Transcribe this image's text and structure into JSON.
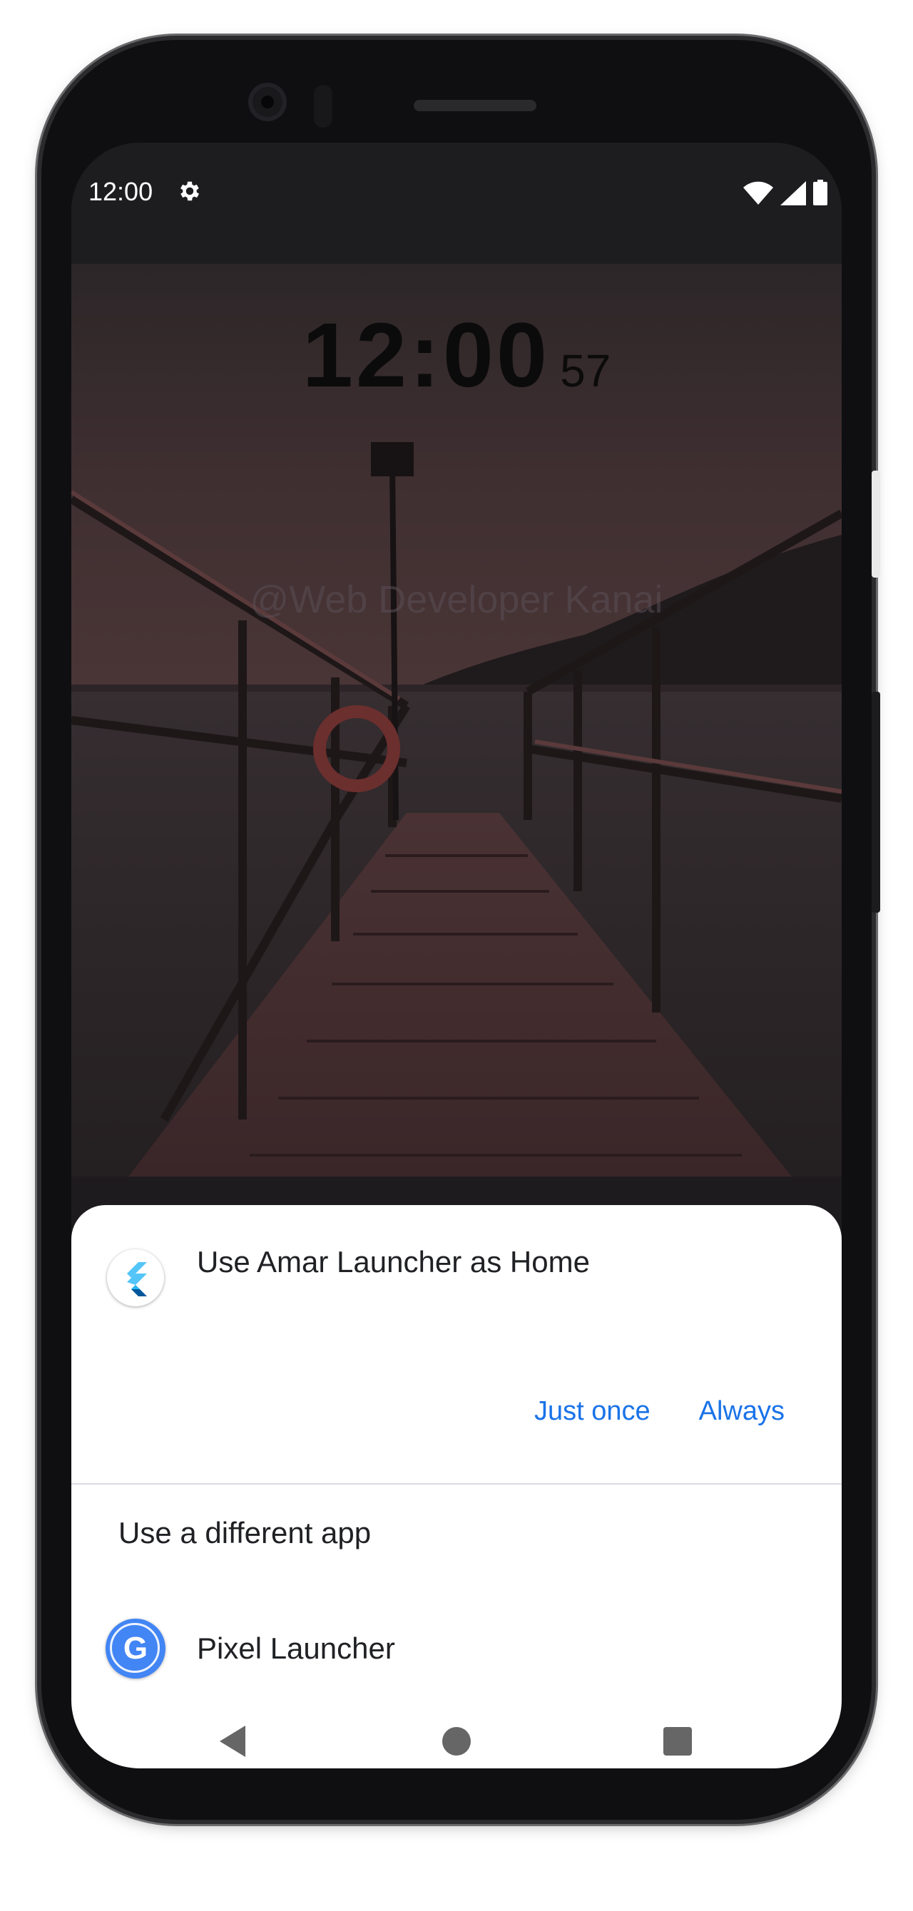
{
  "status_bar": {
    "time": "12:00",
    "icons": [
      "settings-gear-icon",
      "wifi-icon",
      "cell-signal-icon",
      "battery-icon"
    ]
  },
  "lock_clock": {
    "time": "12:00",
    "seconds": "57"
  },
  "watermark": "@Web Developer Kanai",
  "chooser": {
    "title": "Use Amar Launcher as Home",
    "just_once_label": "Just once",
    "always_label": "Always",
    "section_label": "Use a different app",
    "alternative_app": {
      "name": "Pixel Launcher",
      "icon": "google-g-icon"
    }
  },
  "nav_bar": {
    "icons": [
      "back-triangle-icon",
      "home-circle-icon",
      "recents-square-icon"
    ]
  },
  "colors": {
    "accent": "#1a73e8",
    "sheet_bg": "#ffffff",
    "status_bar_bg": "#1d1c1f"
  }
}
